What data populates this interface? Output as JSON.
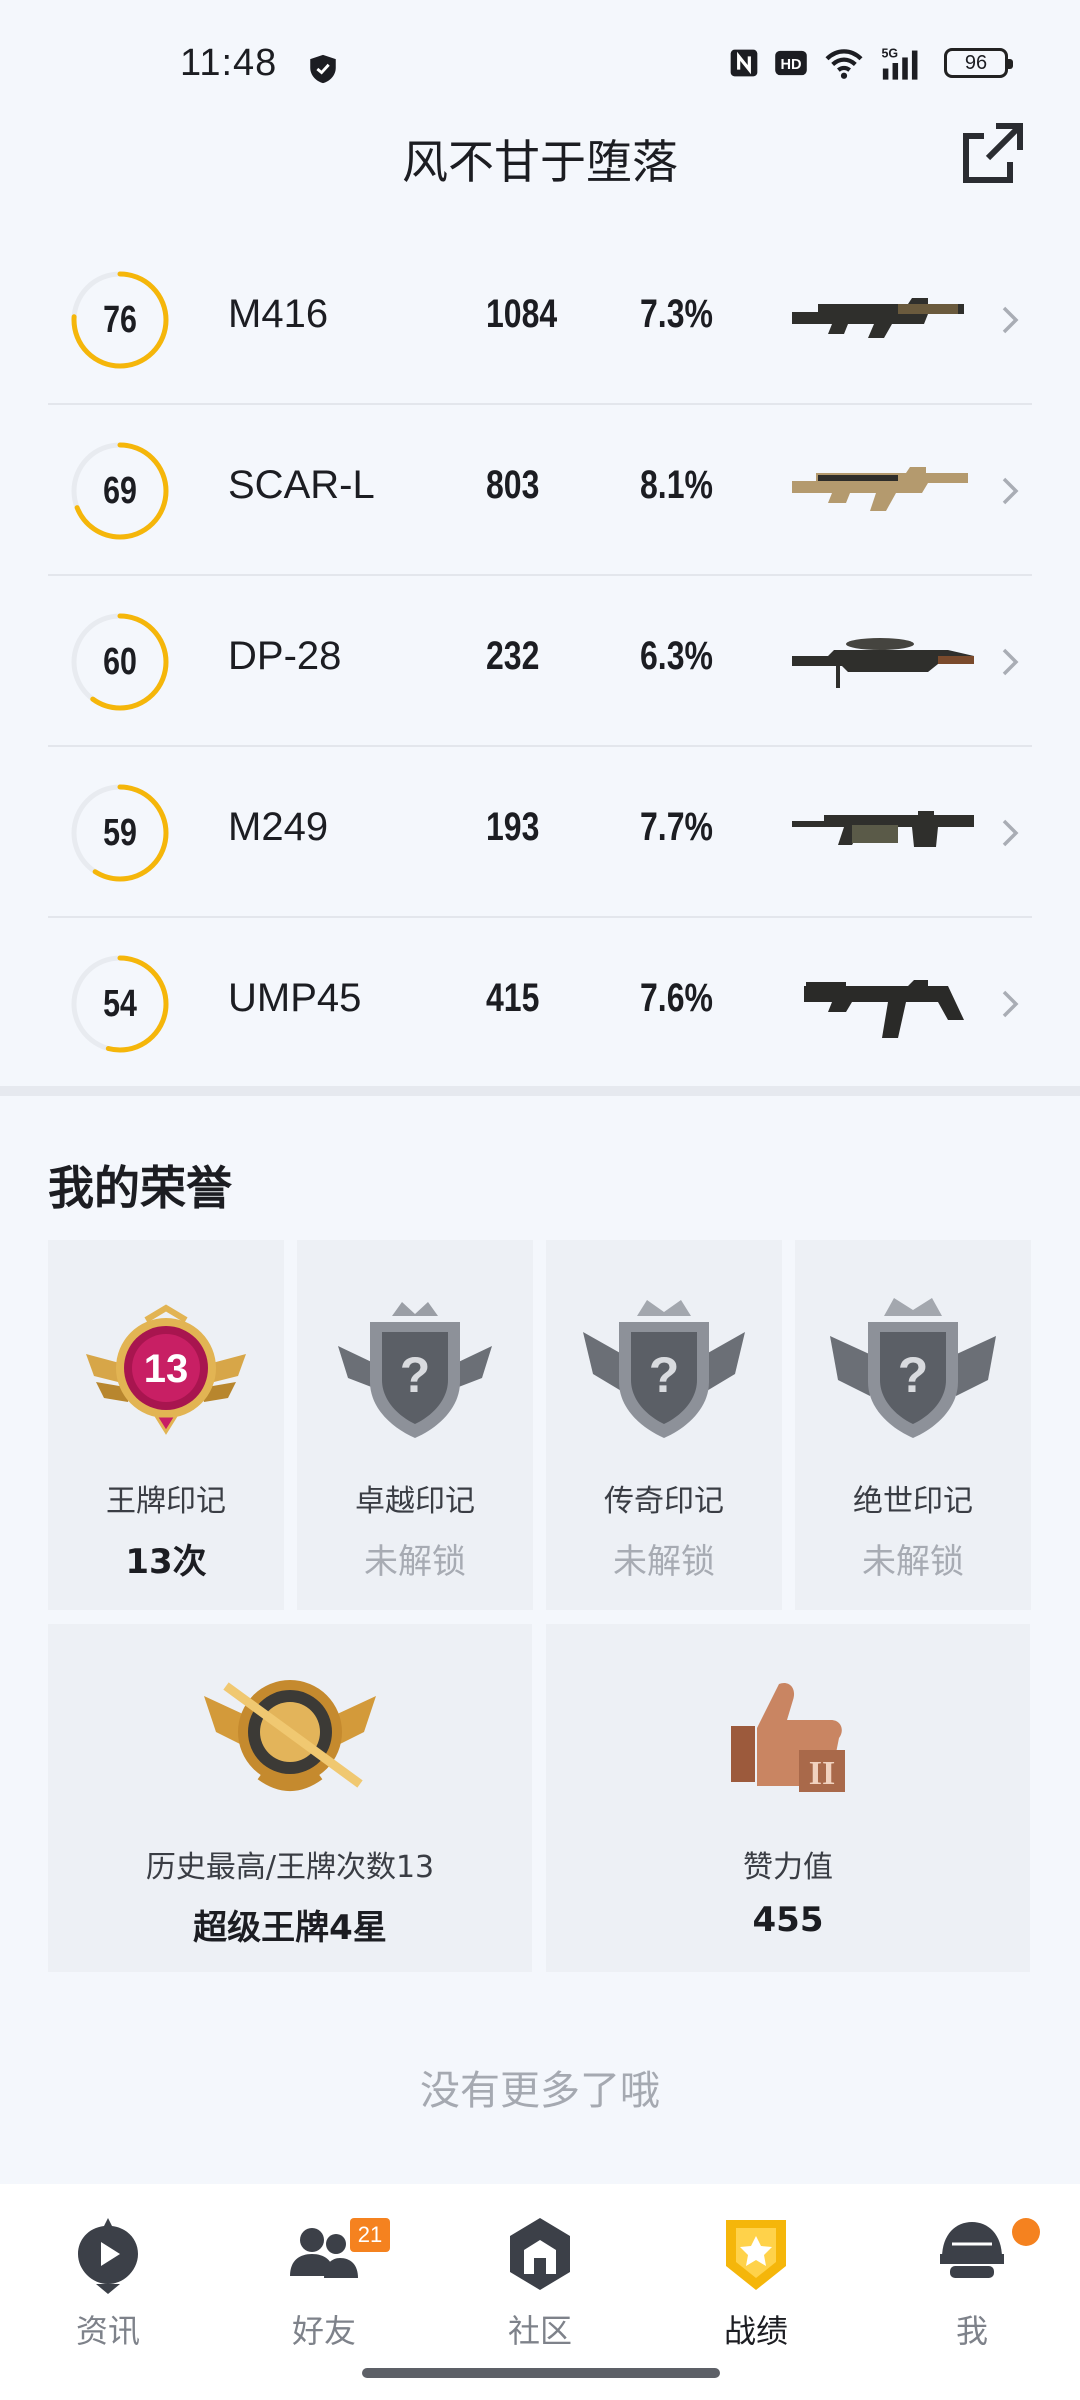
{
  "status_bar": {
    "time": "11:48",
    "icons": [
      "shield-icon",
      "nfc-icon",
      "hd-icon",
      "wifi-icon",
      "signal-5g-icon"
    ],
    "network": "5G",
    "battery": "96"
  },
  "header": {
    "title": "风不甘于堕落",
    "share_icon": "share-external-icon"
  },
  "weapons": [
    {
      "score": "76",
      "score_pct": 0.76,
      "name": "M416",
      "kills": "1084",
      "rate": "7.3%",
      "gun": "m416"
    },
    {
      "score": "69",
      "score_pct": 0.69,
      "name": "SCAR-L",
      "kills": "803",
      "rate": "8.1%",
      "gun": "scar"
    },
    {
      "score": "60",
      "score_pct": 0.6,
      "name": "DP-28",
      "kills": "232",
      "rate": "6.3%",
      "gun": "dp28"
    },
    {
      "score": "59",
      "score_pct": 0.59,
      "name": "M249",
      "kills": "193",
      "rate": "7.7%",
      "gun": "m249"
    },
    {
      "score": "54",
      "score_pct": 0.54,
      "name": "UMP45",
      "kills": "415",
      "rate": "7.6%",
      "gun": "ump"
    }
  ],
  "honors": {
    "title": "我的荣誉",
    "badges": [
      {
        "label": "王牌印记",
        "value": "13次",
        "locked": false,
        "badge_number": "13"
      },
      {
        "label": "卓越印记",
        "value": "未解锁",
        "locked": true
      },
      {
        "label": "传奇印记",
        "value": "未解锁",
        "locked": true
      },
      {
        "label": "绝世印记",
        "value": "未解锁",
        "locked": true
      }
    ],
    "highest": {
      "label": "历史最高/王牌次数13",
      "value": "超级王牌4星"
    },
    "likes": {
      "label": "赞力值",
      "value": "455"
    }
  },
  "no_more_text": "没有更多了哦",
  "colors": {
    "accent": "#f5b60a",
    "badge_orange": "#f5821f",
    "background": "#f4f7fc"
  },
  "bottom_nav": [
    {
      "label": "资讯",
      "icon": "news-play-icon",
      "active": false
    },
    {
      "label": "好友",
      "icon": "friends-icon",
      "active": false,
      "badge": "21"
    },
    {
      "label": "社区",
      "icon": "community-icon",
      "active": false
    },
    {
      "label": "战绩",
      "icon": "record-trophy-icon",
      "active": true
    },
    {
      "label": "我",
      "icon": "helmet-profile-icon",
      "active": false,
      "dot": true
    }
  ]
}
